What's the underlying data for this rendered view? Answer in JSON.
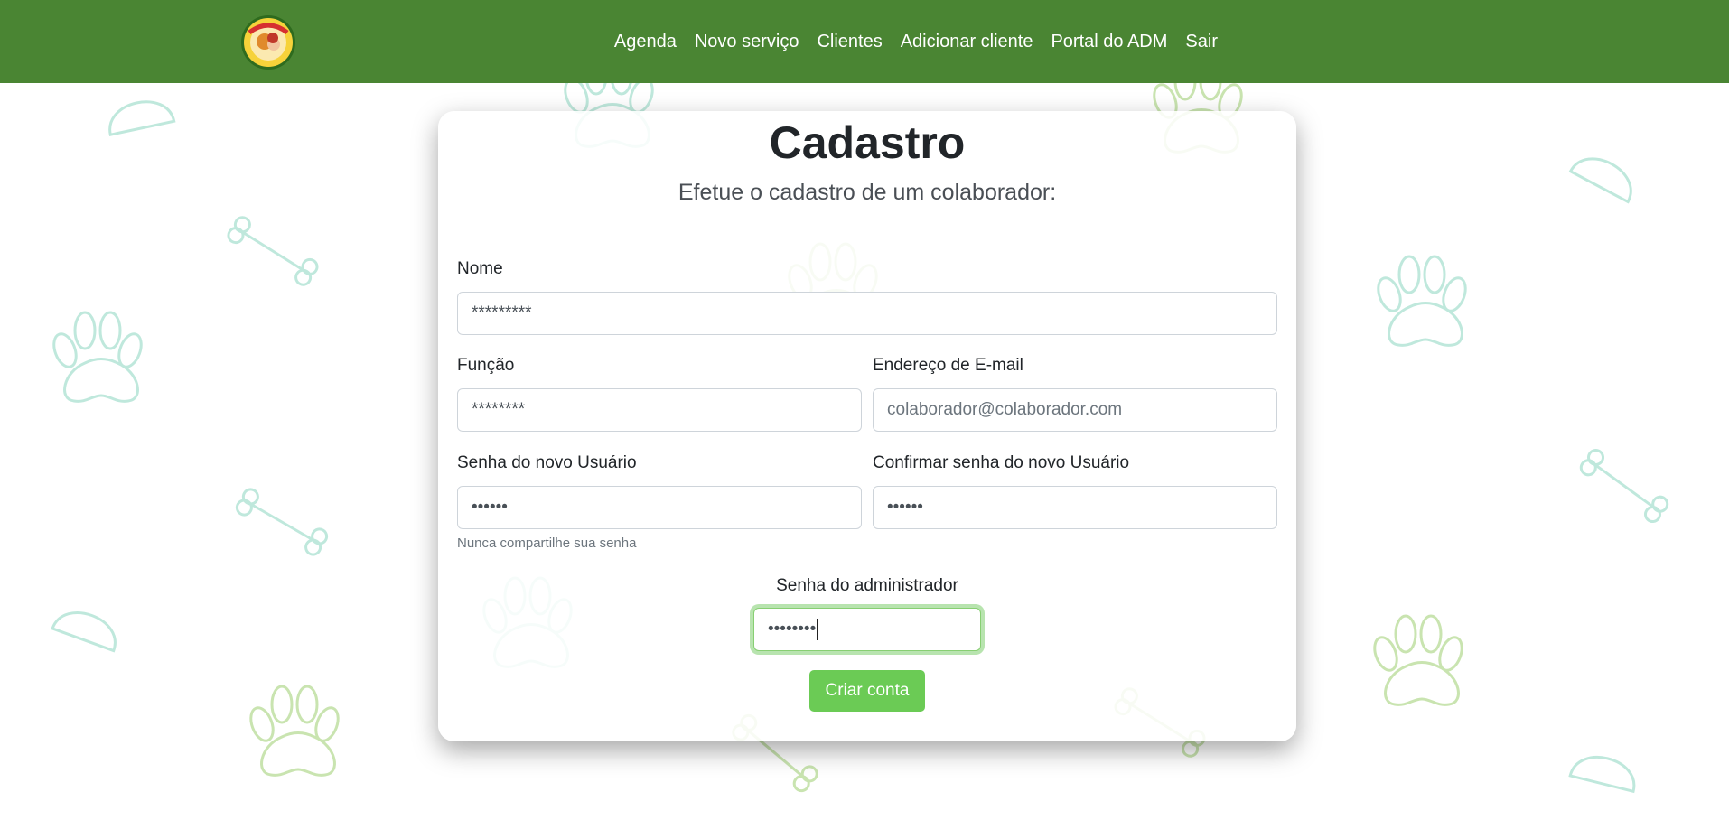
{
  "header": {
    "logo_icon": "viana-pet-logo",
    "nav": [
      {
        "label": "Agenda"
      },
      {
        "label": "Novo serviço"
      },
      {
        "label": "Clientes"
      },
      {
        "label": "Adicionar cliente"
      },
      {
        "label": "Portal do ADM"
      },
      {
        "label": "Sair"
      }
    ]
  },
  "form": {
    "title": "Cadastro",
    "subtitle": "Efetue o cadastro de um colaborador:",
    "name": {
      "label": "Nome",
      "value": "*********"
    },
    "role": {
      "label": "Função",
      "value": "********"
    },
    "email": {
      "label": "Endereço de E-mail",
      "placeholder": "colaborador@colaborador.com"
    },
    "password": {
      "label": "Senha do novo Usuário",
      "value": "••••••",
      "help": "Nunca compartilhe sua senha"
    },
    "confirm_password": {
      "label": "Confirmar senha do novo Usuário",
      "value": "••••••"
    },
    "admin_password": {
      "label": "Senha do administrador",
      "value": "••••••••"
    },
    "submit_label": "Criar conta"
  },
  "colors": {
    "navbar": "#4a8533",
    "button": "#6bcb55",
    "focus_ring": "#88cf73",
    "deco_teal": "#bfe8dc",
    "deco_green": "#c9e4b0"
  }
}
